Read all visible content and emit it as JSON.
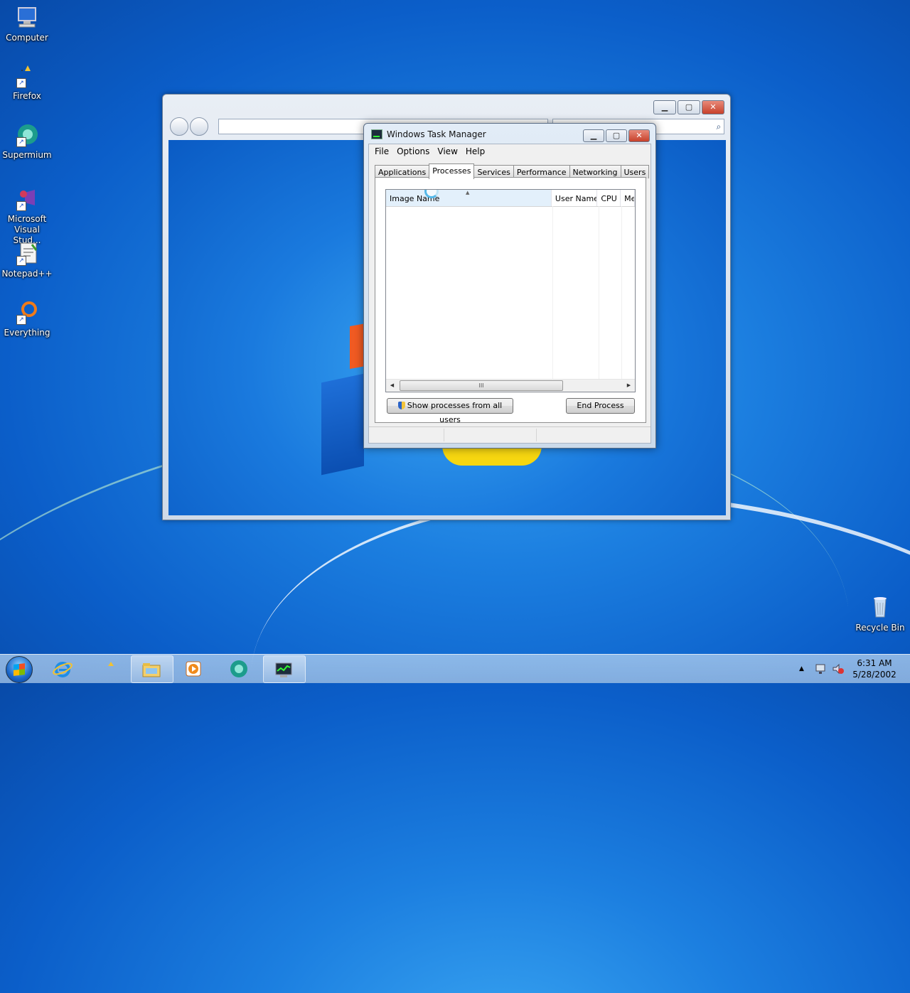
{
  "desktop": {
    "icons": [
      {
        "label": "Computer"
      },
      {
        "label": "Firefox"
      },
      {
        "label": "Supermium"
      },
      {
        "label_line1": "Microsoft",
        "label_line2": "Visual Stud..."
      },
      {
        "label": "Notepad++"
      },
      {
        "label": "Everything"
      },
      {
        "label": "Recycle Bin"
      }
    ]
  },
  "task_manager": {
    "title": "Windows Task Manager",
    "menu": [
      "File",
      "Options",
      "View",
      "Help"
    ],
    "tabs": [
      "Applications",
      "Processes",
      "Services",
      "Performance",
      "Networking",
      "Users"
    ],
    "active_tab": "Processes",
    "columns": [
      "Image Name",
      "User Name",
      "CPU",
      "Me"
    ],
    "scroll_grip": "III",
    "show_all_button": "Show processes from all users",
    "end_process_button": "End Process"
  },
  "taskbar": {
    "clock_time": "6:31 AM",
    "clock_date": "5/28/2002"
  },
  "colors": {
    "desktop_blue": "#1c7fe0",
    "taskbar": "#a9c8ea",
    "close_red": "#c7412b"
  }
}
